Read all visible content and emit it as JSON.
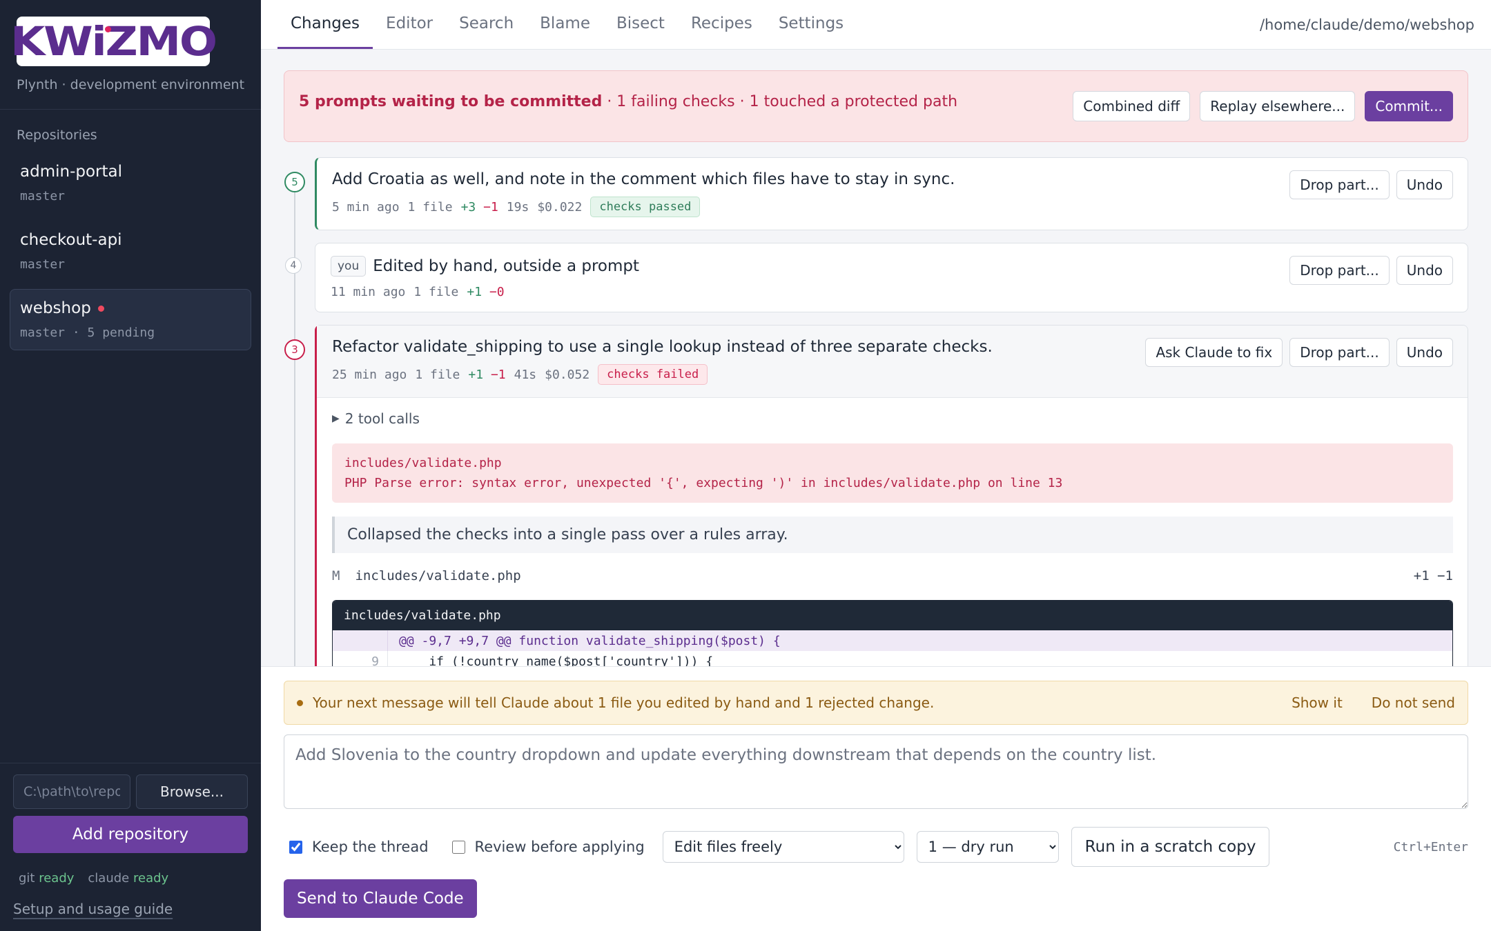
{
  "brand": {
    "logo_text": "KWiZMO",
    "tagline": "Plynth · development environment"
  },
  "sidebar": {
    "section_label": "Repositories",
    "repos": [
      {
        "name": "admin-portal",
        "branch": "master"
      },
      {
        "name": "checkout-api",
        "branch": "master"
      },
      {
        "name": "webshop",
        "branch": "master · 5 pending"
      }
    ],
    "path_placeholder": "C:\\path\\to\\repo",
    "browse_label": "Browse...",
    "add_label": "Add repository",
    "status": {
      "git_label": "git",
      "git_state": "ready",
      "claude_label": "claude",
      "claude_state": "ready"
    },
    "guide_label": "Setup and usage guide"
  },
  "nav": {
    "tabs": [
      "Changes",
      "Editor",
      "Search",
      "Blame",
      "Bisect",
      "Recipes",
      "Settings"
    ],
    "path": "/home/claude/demo/webshop"
  },
  "banner": {
    "strong": "5 prompts waiting to be committed",
    "rest": " · 1 failing checks · 1 touched a protected path",
    "combined_label": "Combined diff",
    "replay_label": "Replay elsewhere...",
    "commit_label": "Commit..."
  },
  "entries": [
    {
      "num": "5",
      "title": "Add Croatia as well, and note in the comment which files have to stay in sync.",
      "time": "5 min ago",
      "files": "1 file",
      "plus": "+3",
      "minus": "−1",
      "duration": "19s",
      "cost": "$0.022",
      "status": "checks passed",
      "drop_label": "Drop part...",
      "undo_label": "Undo"
    },
    {
      "num": "4",
      "tag": "you",
      "title": "Edited by hand, outside a prompt",
      "time": "11 min ago",
      "files": "1 file",
      "plus": "+1",
      "minus": "−0",
      "drop_label": "Drop part...",
      "undo_label": "Undo"
    },
    {
      "num": "3",
      "title": "Refactor validate_shipping to use a single lookup instead of three separate checks.",
      "time": "25 min ago",
      "files": "1 file",
      "plus": "+1",
      "minus": "−1",
      "duration": "41s",
      "cost": "$0.052",
      "status": "checks failed",
      "fix_label": "Ask Claude to fix",
      "drop_label": "Drop part...",
      "undo_label": "Undo",
      "tool_calls": "2 tool calls",
      "error_file": "includes/validate.php",
      "error_msg": "PHP Parse error:  syntax error, unexpected '{', expecting ')' in includes/validate.php on line 13",
      "summary": "Collapsed the checks into a single pass over a rules array.",
      "changed_file": {
        "mode": "M",
        "path": "includes/validate.php",
        "stats": "+1 −1"
      },
      "diff": {
        "file": "includes/validate.php",
        "hunk": "@@ -9,7 +9,7 @@ function validate_shipping($post) {",
        "line_no": "9",
        "line": "    if (!country_name($post['country'])) {"
      }
    }
  ],
  "composer": {
    "notice": "Your next message will tell Claude about 1 file you edited by hand and 1 rejected change.",
    "show_label": "Show it",
    "dont_send_label": "Do not send",
    "prompt_placeholder": "Add Slovenia to the country dropdown and update everything downstream that depends on the country list.",
    "keep_thread_label": "Keep the thread",
    "review_label": "Review before applying",
    "mode_selected": "Edit files freely",
    "runs_selected": "1 — dry run",
    "scratch_label": "Run in a scratch copy",
    "shortcut": "Ctrl+Enter",
    "send_label": "Send to Claude Code"
  }
}
